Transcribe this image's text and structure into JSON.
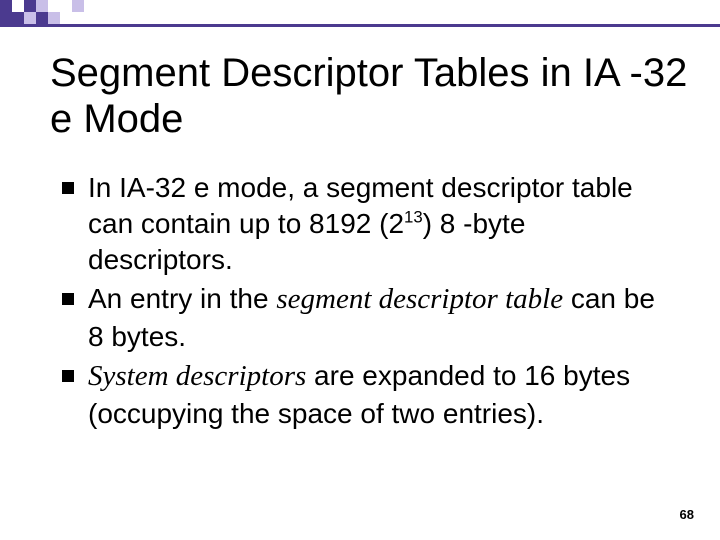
{
  "title": "Segment Descriptor Tables in IA -32 e Mode",
  "bullets": [
    {
      "pre": "In IA-32 e mode, a segment descriptor table can contain up to 8192 (2",
      "sup": "13",
      "post": ") 8 -byte descriptors."
    },
    {
      "pre": "An entry in the ",
      "italic": "segment descriptor table",
      "post": " can be 8 bytes."
    },
    {
      "italic": "System descriptors",
      "post": " are expanded to 16 bytes (occupying the space of two entries)."
    }
  ],
  "page_number": "68"
}
